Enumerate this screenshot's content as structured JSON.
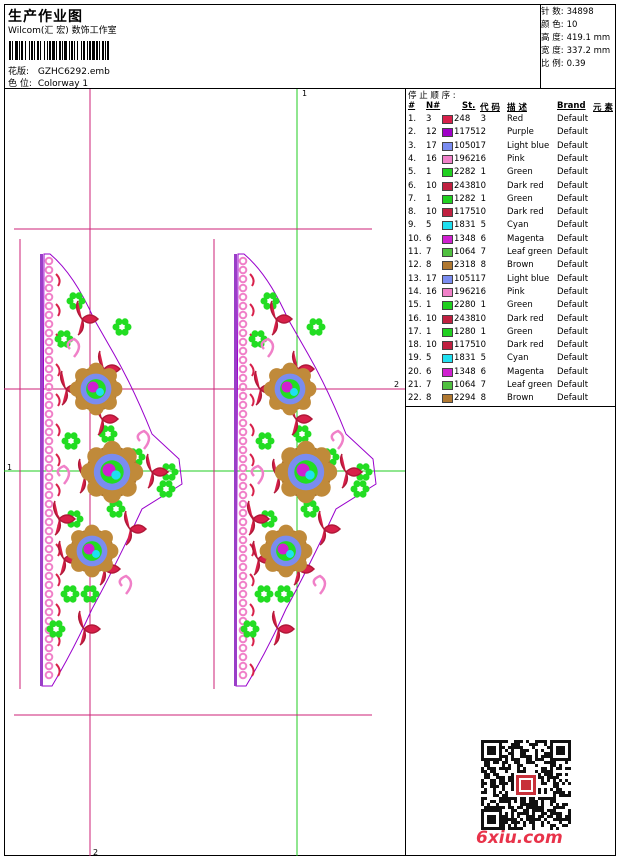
{
  "header": {
    "title": "生产作业图",
    "subtitle": "Wilcom(汇 宏) 数饰工作室",
    "pattern_label": "花版:",
    "pattern_value": "GZHC6292.emb",
    "color_label": "色 位:",
    "color_value": "Colorway 1"
  },
  "stats": [
    {
      "label": "针 数:",
      "value": "34898"
    },
    {
      "label": "颜 色:",
      "value": "10"
    },
    {
      "label": "高 度:",
      "value": "419.1 mm"
    },
    {
      "label": "宽 度:",
      "value": "337.2 mm"
    },
    {
      "label": "比 例:",
      "value": "0.39"
    }
  ],
  "legend": {
    "title": "停 止 顺 序 :",
    "headers": [
      "#",
      "N#",
      "St.",
      "代 码",
      "描 述",
      "Brand",
      "元 素"
    ],
    "rows": [
      {
        "n": "1.",
        "c": "3",
        "st": "248",
        "code": "3",
        "desc": "Red",
        "brand": "Default",
        "color": "#d8204a"
      },
      {
        "n": "2.",
        "c": "12",
        "st": "1175",
        "code": "12",
        "desc": "Purple",
        "brand": "Default",
        "color": "#a000c8"
      },
      {
        "n": "3.",
        "c": "17",
        "st": "1050",
        "code": "17",
        "desc": "Light blue",
        "brand": "Default",
        "color": "#7a8cf0"
      },
      {
        "n": "4.",
        "c": "16",
        "st": "1962",
        "code": "16",
        "desc": "Pink",
        "brand": "Default",
        "color": "#f080c8"
      },
      {
        "n": "5.",
        "c": "1",
        "st": "2282",
        "code": "1",
        "desc": "Green",
        "brand": "Default",
        "color": "#20d020"
      },
      {
        "n": "6.",
        "c": "10",
        "st": "2438",
        "code": "10",
        "desc": "Dark red",
        "brand": "Default",
        "color": "#c02040"
      },
      {
        "n": "7.",
        "c": "1",
        "st": "1282",
        "code": "1",
        "desc": "Green",
        "brand": "Default",
        "color": "#20d020"
      },
      {
        "n": "8.",
        "c": "10",
        "st": "1175",
        "code": "10",
        "desc": "Dark red",
        "brand": "Default",
        "color": "#c02040"
      },
      {
        "n": "9.",
        "c": "5",
        "st": "1831",
        "code": "5",
        "desc": "Cyan",
        "brand": "Default",
        "color": "#20e0f0"
      },
      {
        "n": "10.",
        "c": "6",
        "st": "1348",
        "code": "6",
        "desc": "Magenta",
        "brand": "Default",
        "color": "#d020d0"
      },
      {
        "n": "11.",
        "c": "7",
        "st": "1064",
        "code": "7",
        "desc": "Leaf green",
        "brand": "Default",
        "color": "#50c040"
      },
      {
        "n": "12.",
        "c": "8",
        "st": "2318",
        "code": "8",
        "desc": "Brown",
        "brand": "Default",
        "color": "#b07830"
      },
      {
        "n": "13.",
        "c": "17",
        "st": "1051",
        "code": "17",
        "desc": "Light blue",
        "brand": "Default",
        "color": "#7a8cf0"
      },
      {
        "n": "14.",
        "c": "16",
        "st": "1962",
        "code": "16",
        "desc": "Pink",
        "brand": "Default",
        "color": "#f080c8"
      },
      {
        "n": "15.",
        "c": "1",
        "st": "2280",
        "code": "1",
        "desc": "Green",
        "brand": "Default",
        "color": "#20d020"
      },
      {
        "n": "16.",
        "c": "10",
        "st": "2438",
        "code": "10",
        "desc": "Dark red",
        "brand": "Default",
        "color": "#c02040"
      },
      {
        "n": "17.",
        "c": "1",
        "st": "1280",
        "code": "1",
        "desc": "Green",
        "brand": "Default",
        "color": "#20d020"
      },
      {
        "n": "18.",
        "c": "10",
        "st": "1175",
        "code": "10",
        "desc": "Dark red",
        "brand": "Default",
        "color": "#c02040"
      },
      {
        "n": "19.",
        "c": "5",
        "st": "1831",
        "code": "5",
        "desc": "Cyan",
        "brand": "Default",
        "color": "#20e0f0"
      },
      {
        "n": "20.",
        "c": "6",
        "st": "1348",
        "code": "6",
        "desc": "Magenta",
        "brand": "Default",
        "color": "#d020d0"
      },
      {
        "n": "21.",
        "c": "7",
        "st": "1064",
        "code": "7",
        "desc": "Leaf green",
        "brand": "Default",
        "color": "#50c040"
      },
      {
        "n": "22.",
        "c": "8",
        "st": "2294",
        "code": "8",
        "desc": "Brown",
        "brand": "Default",
        "color": "#b07830"
      }
    ]
  },
  "guides": {
    "top_marker": "1",
    "right_marker": "2",
    "left_marker": "1",
    "bottom_marker": "2"
  },
  "watermark": "6xiu.com",
  "colors": {
    "guide_green": "#22cc22",
    "guide_magenta": "#cc2277",
    "outline_purple": "#9900cc"
  }
}
